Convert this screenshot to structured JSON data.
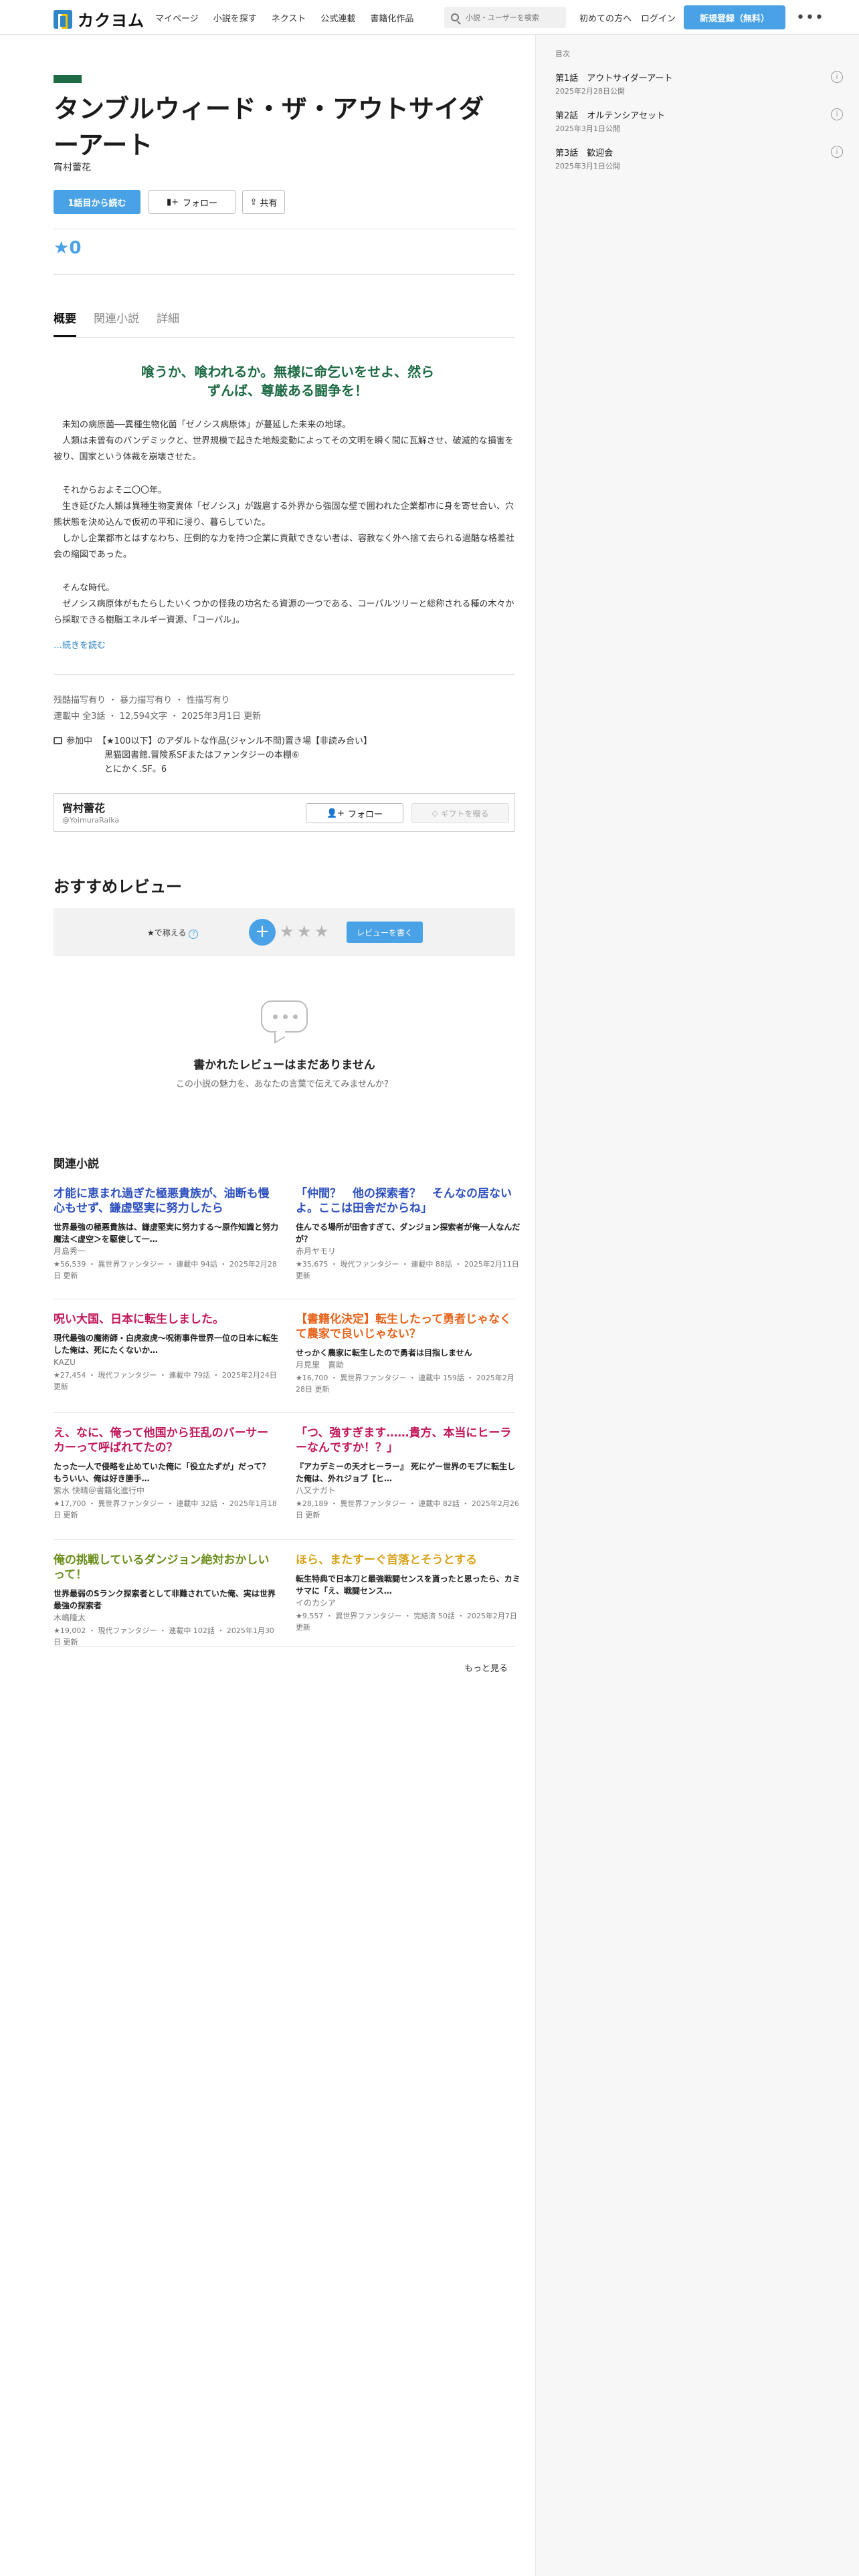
{
  "header": {
    "logo_text": "カクヨム",
    "nav": [
      "マイページ",
      "小説を探す",
      "ネクスト",
      "公式連載",
      "書籍化作品"
    ],
    "search_placeholder": "小説・ユーザーを検索",
    "first_time": "初めての方へ",
    "login": "ログイン",
    "signup": "新規登録（無料）",
    "more": "•••"
  },
  "work": {
    "title": "タンブルウィード・ザ・アウトサイダーアート",
    "author": "宵村蕾花",
    "read_button": "1話目から読む",
    "follow_button": "フォロー",
    "share_button": "共有",
    "rating": "0",
    "tabs": [
      "概要",
      "関連小説",
      "詳細"
    ],
    "catchphrase": "喰うか、喰われるか。無様に命乞いをせよ、然らずんば、尊厳ある闘争を！",
    "synopsis": [
      "　未知の病原菌──異種生物化菌「ゼノシス病原体」が蔓延した未来の地球。",
      "　人類は未曾有のパンデミックと、世界規模で起きた地殻変動によってその文明を瞬く間に瓦解させ、破滅的な損害を被り、国家という体裁を崩壊させた。",
      "",
      "　それからおよそ二〇〇年。",
      "　生き延びた人類は異種生物変異体「ゼノシス」が跋扈する外界から強固な壁で囲われた企業都市に身を寄せ合い、穴熊状態を決め込んで仮初の平和に浸り、暮らしていた。",
      "　しかし企業都市とはすなわち、圧倒的な力を持つ企業に貢献できない者は、容赦なく外へ捨て去られる過酷な格差社会の縮図であった。",
      "",
      "　そんな時代。",
      "　ゼノシス病原体がもたらしたいくつかの怪我の功名たる資源の一つである、コーパルツリーと総称される種の木々から採取できる樹脂エネルギー資源、「コーパル」。"
    ],
    "read_more": "…続きを読む",
    "tags": "残酷描写有り ・ 暴力描写有り ・ 性描写有り",
    "meta": "連載中 全3話 ・ 12,594文字 ・ 2025年3月1日 更新",
    "contest_label": "参加中",
    "contest_lines": [
      "【★100以下】のアダルトな作品(ジャンル不問)置き場【非読み合い】",
      "黒猫図書館.冒険系SFまたはファンタジーの本棚⑥",
      "とにかく.SF。6"
    ]
  },
  "author_box": {
    "name": "宵村蕾花",
    "id": "@YoimuraRaika",
    "follow": "フォロー",
    "gift": "ギフトを贈る"
  },
  "reviews": {
    "heading": "おすすめレビュー",
    "label": "★で称える",
    "help": "?",
    "plus": "+",
    "write_button": "レビューを書く",
    "empty_title": "書かれたレビューはまだありません",
    "empty_sub": "この小説の魅力を、あなたの言葉で伝えてみませんか？"
  },
  "related": {
    "heading": "関連小説",
    "more": "もっと見る",
    "items": [
      {
        "title": "才能に恵まれ過ぎた極悪貴族が、油断も慢心もせず、鎌虚堅実に努力したら",
        "catch": "世界最強の極悪貴族は、鎌虚堅実に努力する〜原作知識と努力魔法＜虚空＞を駆使して一…",
        "author": "月島秀一",
        "meta": "★56,539 ・ 異世界ファンタジー ・ 連載中 94話 ・ 2025年2月28日 更新",
        "color": "#2c4fbf"
      },
      {
        "title": "「仲間？　他の探索者？　そんなの居ないよ。ここは田舎だからね」",
        "catch": "住んでる場所が田舎すぎて、ダンジョン探索者が俺一人なんだが？",
        "author": "赤月ヤモリ",
        "meta": "★35,675 ・ 現代ファンタジー ・ 連載中 88話 ・ 2025年2月11日 更新",
        "color": "#2c4fbf"
      },
      {
        "title": "呪い大国、日本に転生しました。",
        "catch": "現代最強の魔術師・白虎寂虎〜呪術事件世界一位の日本に転生した俺は、死にたくないか…",
        "author": "KAZU",
        "meta": "★27,454 ・ 現代ファンタジー ・ 連載中 79話 ・ 2025年2月24日 更新",
        "color": "#c2185b"
      },
      {
        "title": "【書籍化決定】転生したって勇者じゃなくて農家で良いじゃない？",
        "catch": "せっかく農家に転生したので勇者は目指しません",
        "author": "月見里　喜助",
        "meta": "★16,700 ・ 異世界ファンタジー ・ 連載中 159話 ・ 2025年2月28日 更新",
        "color": "#e8631a"
      },
      {
        "title": "え、なに、俺って他国から狂乱のバーサーカーって呼ばれてたの？",
        "catch": "たった一人で侵略を止めていた俺に「役立たずが」だって？　もういい、俺は好き勝手…",
        "author": "紫水 快晴＠書籍化進行中",
        "meta": "★17,700 ・ 異世界ファンタジー ・ 連載中 32話 ・ 2025年1月18日 更新",
        "color": "#c2185b"
      },
      {
        "title": "「つ、強すぎます……貴方、本当にヒーラーなんですか！？」",
        "catch": "『アカデミーの天才ヒーラー』 死にゲー世界のモブに転生した俺は、外れジョブ【ヒ…",
        "author": "八又ナガト",
        "meta": "★28,189 ・ 異世界ファンタジー ・ 連載中 82話 ・ 2025年2月26日 更新",
        "color": "#c2185b"
      },
      {
        "title": "俺の挑戦しているダンジョン絶対おかしいって！",
        "catch": "世界最弱のSランク探索者として非難されていた俺、実は世界最強の探索者",
        "author": "木嶋隆太",
        "meta": "★19,002 ・ 現代ファンタジー ・ 連載中 102話 ・ 2025年1月30日 更新",
        "color": "#6a8e1a"
      },
      {
        "title": "ほら、またすーぐ首落とそうとする",
        "catch": "転生特典で日本刀と最強戦闘センスを貰ったと思ったら、カミサマに「え、戦闘センス…",
        "author": "イのカシア",
        "meta": "★9,557 ・ 異世界ファンタジー ・ 完結済 50話 ・ 2025年2月7日 更新",
        "color": "#d9a21a"
      }
    ]
  },
  "toc": {
    "label": "目次",
    "episodes": [
      {
        "title": "第1話　アウトサイダーアート",
        "date": "2025年2月28日公開"
      },
      {
        "title": "第2話　オルテンシアセット",
        "date": "2025年3月1日公開"
      },
      {
        "title": "第3話　歓迎会",
        "date": "2025年3月1日公開"
      }
    ],
    "info": "i"
  }
}
